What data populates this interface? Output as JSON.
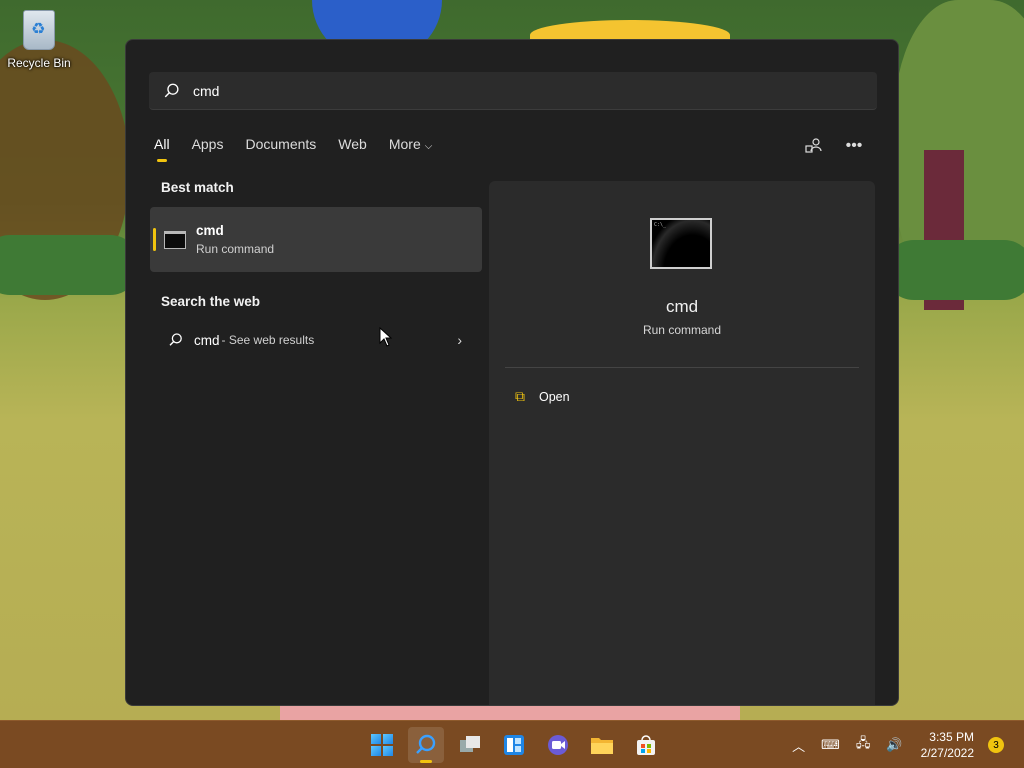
{
  "desktop": {
    "recycle_bin_label": "Recycle Bin"
  },
  "search": {
    "query": "cmd"
  },
  "tabs": [
    {
      "label": "All",
      "active": true
    },
    {
      "label": "Apps"
    },
    {
      "label": "Documents"
    },
    {
      "label": "Web"
    },
    {
      "label": "More"
    }
  ],
  "left": {
    "best_match_title": "Best match",
    "best_match": {
      "name": "cmd",
      "subtitle": "Run command"
    },
    "search_web_title": "Search the web",
    "web_result": {
      "query": "cmd",
      "suffix": " - See web results"
    }
  },
  "right": {
    "title": "cmd",
    "subtitle": "Run command",
    "action_open": "Open"
  },
  "taskbar": {
    "time": "3:35 PM",
    "date": "2/27/2022",
    "notifications": "3"
  },
  "colors": {
    "accent": "#f1c40f",
    "panel_bg": "#202020",
    "taskbar_bg": "#7a4a22"
  }
}
